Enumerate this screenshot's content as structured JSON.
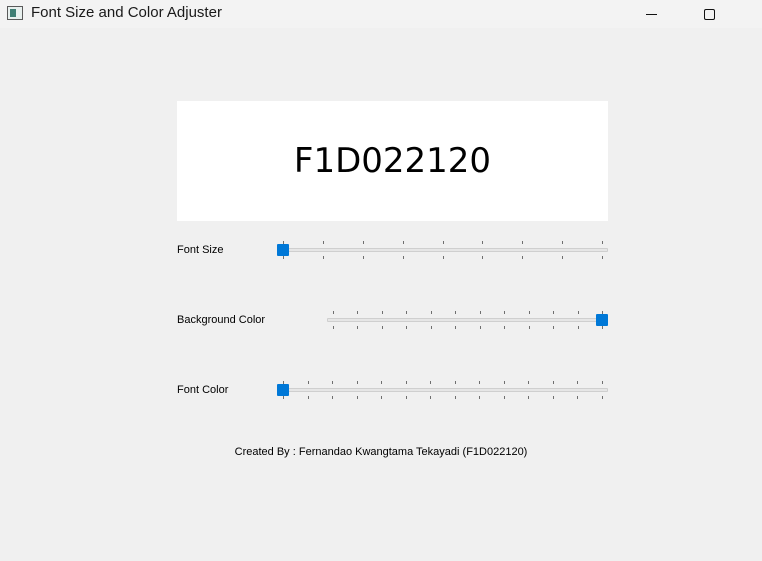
{
  "window": {
    "title": "Font Size and Color Adjuster",
    "icon": "app-window-icon"
  },
  "display": {
    "text": "F1D022120",
    "background_color": "#ffffff",
    "font_color": "#000000"
  },
  "controls": {
    "font_size": {
      "label": "Font Size",
      "value_fraction": 0.0,
      "tick_count": 9
    },
    "background_color": {
      "label": "Background Color",
      "value_fraction": 1.0,
      "tick_count": 12
    },
    "font_color": {
      "label": "Font Color",
      "value_fraction": 0.0,
      "tick_count": 14
    }
  },
  "footer": {
    "text": "Created By : Fernandao Kwangtama Tekayadi (F1D022120)"
  },
  "colors": {
    "accent": "#0078d7",
    "window_bg": "#f0f0f0"
  }
}
